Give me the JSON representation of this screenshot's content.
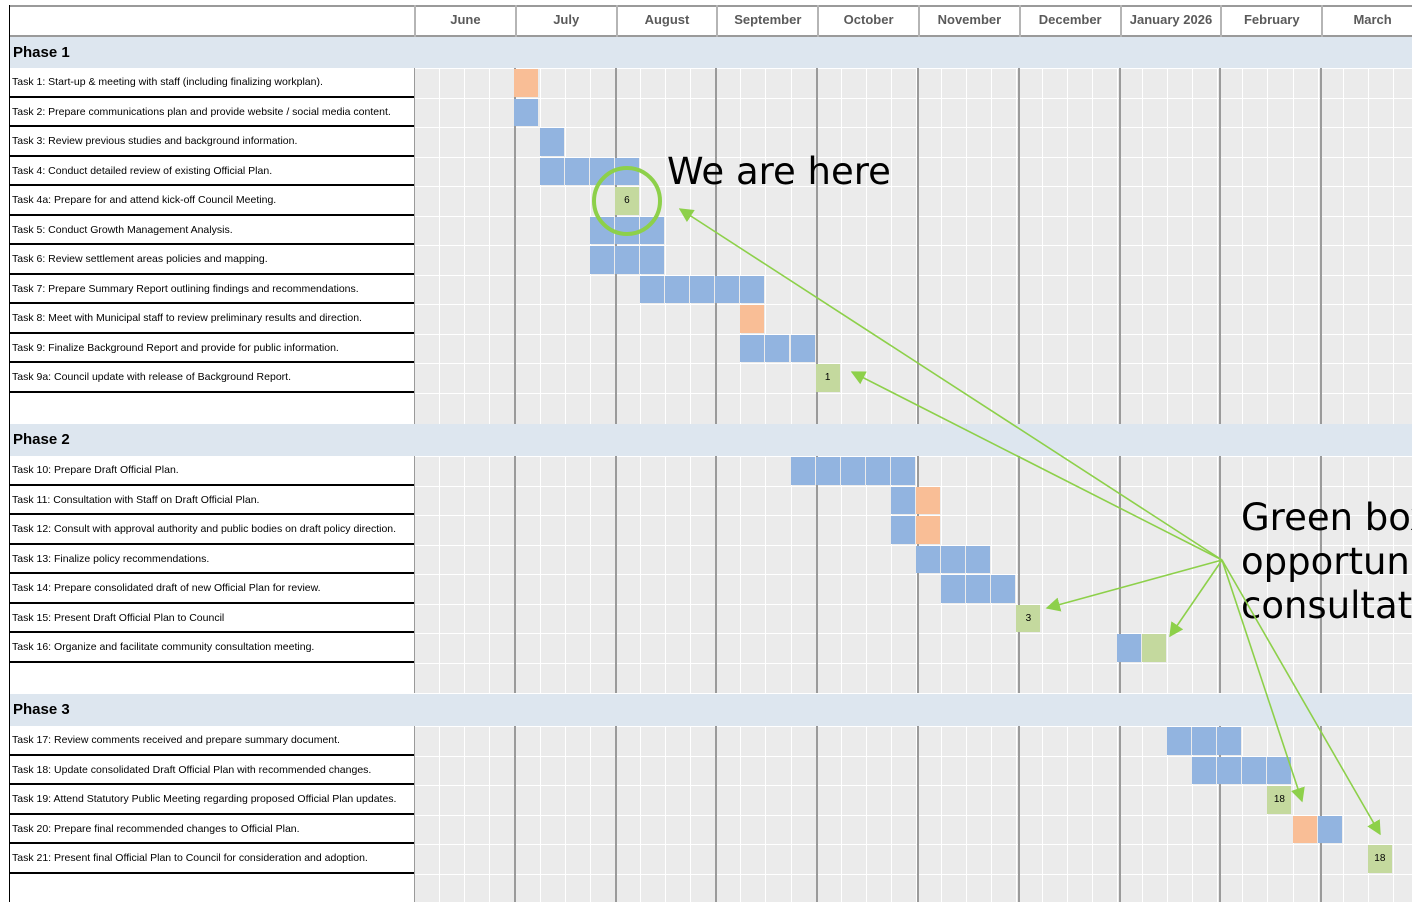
{
  "months": [
    "June",
    "July",
    "August",
    "September",
    "October",
    "November",
    "December",
    "January 2026",
    "February",
    "March"
  ],
  "colors": {
    "task": "#92b4e0",
    "meeting": "#f9be96",
    "consult": "#c4d99e",
    "phase_bg": "#dde6ef",
    "grid_bg": "#ebebeb",
    "arrow": "#8dd04a"
  },
  "phases": [
    {
      "name": "Phase 1",
      "tasks": [
        {
          "label": "Task 1: Start-up & meeting with staff (including finalizing workplan).",
          "cells": [
            {
              "week": 4,
              "kind": "meeting"
            }
          ]
        },
        {
          "label": "Task 2: Prepare communications plan and provide website / social media content.",
          "cells": [
            {
              "week": 4,
              "kind": "task"
            }
          ]
        },
        {
          "label": "Task 3: Review previous studies and background information.",
          "cells": [
            {
              "week": 5,
              "kind": "task"
            }
          ]
        },
        {
          "label": "Task 4: Conduct detailed review of existing Official Plan.",
          "cells": [
            {
              "week": 5,
              "kind": "task"
            },
            {
              "week": 6,
              "kind": "task"
            },
            {
              "week": 7,
              "kind": "task"
            },
            {
              "week": 8,
              "kind": "task"
            }
          ]
        },
        {
          "label": "Task 4a: Prepare for and attend kick-off Council Meeting.",
          "cells": [
            {
              "week": 8,
              "kind": "consult",
              "text": "6"
            }
          ]
        },
        {
          "label": "Task 5: Conduct Growth Management Analysis.",
          "cells": [
            {
              "week": 7,
              "kind": "task"
            },
            {
              "week": 8,
              "kind": "task"
            },
            {
              "week": 9,
              "kind": "task"
            }
          ]
        },
        {
          "label": "Task 6: Review settlement areas policies and mapping.",
          "cells": [
            {
              "week": 7,
              "kind": "task"
            },
            {
              "week": 8,
              "kind": "task"
            },
            {
              "week": 9,
              "kind": "task"
            }
          ]
        },
        {
          "label": "Task 7: Prepare Summary Report outlining findings and recommendations.",
          "cells": [
            {
              "week": 9,
              "kind": "task"
            },
            {
              "week": 10,
              "kind": "task"
            },
            {
              "week": 11,
              "kind": "task"
            },
            {
              "week": 12,
              "kind": "task"
            },
            {
              "week": 13,
              "kind": "task"
            }
          ]
        },
        {
          "label": "Task 8: Meet with Municipal staff to review preliminary results and direction.",
          "cells": [
            {
              "week": 13,
              "kind": "meeting"
            }
          ]
        },
        {
          "label": "Task 9: Finalize Background Report and provide for public information.",
          "cells": [
            {
              "week": 13,
              "kind": "task"
            },
            {
              "week": 14,
              "kind": "task"
            },
            {
              "week": 15,
              "kind": "task"
            }
          ]
        },
        {
          "label": "Task 9a: Council update with release of Background Report.",
          "cells": [
            {
              "week": 16,
              "kind": "consult",
              "text": "1"
            }
          ]
        }
      ]
    },
    {
      "name": "Phase 2",
      "tasks": [
        {
          "label": "Task 10: Prepare Draft Official Plan.",
          "cells": [
            {
              "week": 15,
              "kind": "task"
            },
            {
              "week": 16,
              "kind": "task"
            },
            {
              "week": 17,
              "kind": "task"
            },
            {
              "week": 18,
              "kind": "task"
            },
            {
              "week": 19,
              "kind": "task"
            }
          ]
        },
        {
          "label": "Task 11: Consultation with Staff on Draft Official Plan.",
          "cells": [
            {
              "week": 19,
              "kind": "task"
            },
            {
              "week": 20,
              "kind": "meeting"
            }
          ]
        },
        {
          "label": "Task 12: Consult with approval authority and public bodies on draft policy direction.",
          "cells": [
            {
              "week": 19,
              "kind": "task"
            },
            {
              "week": 20,
              "kind": "meeting"
            }
          ]
        },
        {
          "label": "Task 13: Finalize policy recommendations.",
          "cells": [
            {
              "week": 20,
              "kind": "task"
            },
            {
              "week": 21,
              "kind": "task"
            },
            {
              "week": 22,
              "kind": "task"
            }
          ]
        },
        {
          "label": "Task 14: Prepare consolidated draft of new Official Plan for review.",
          "cells": [
            {
              "week": 21,
              "kind": "task"
            },
            {
              "week": 22,
              "kind": "task"
            },
            {
              "week": 23,
              "kind": "task"
            }
          ]
        },
        {
          "label": "Task 15: Present Draft Official Plan to Council",
          "cells": [
            {
              "week": 24,
              "kind": "consult",
              "text": "3"
            }
          ]
        },
        {
          "label": "Task 16: Organize and facilitate community consultation meeting.",
          "cells": [
            {
              "week": 28,
              "kind": "task"
            },
            {
              "week": 29,
              "kind": "consult"
            }
          ]
        }
      ]
    },
    {
      "name": "Phase 3",
      "tasks": [
        {
          "label": "Task 17: Review comments received and prepare summary document.",
          "cells": [
            {
              "week": 30,
              "kind": "task"
            },
            {
              "week": 31,
              "kind": "task"
            },
            {
              "week": 32,
              "kind": "task"
            }
          ]
        },
        {
          "label": "Task 18: Update consolidated Draft Official Plan with recommended changes.",
          "cells": [
            {
              "week": 31,
              "kind": "task"
            },
            {
              "week": 32,
              "kind": "task"
            },
            {
              "week": 33,
              "kind": "task"
            },
            {
              "week": 34,
              "kind": "task"
            }
          ]
        },
        {
          "label": "Task 19: Attend Statutory Public Meeting regarding proposed Official Plan updates.",
          "cells": [
            {
              "week": 34,
              "kind": "consult",
              "text": "18"
            }
          ]
        },
        {
          "label": "Task 20: Prepare final recommended changes to Official Plan.",
          "cells": [
            {
              "week": 35,
              "kind": "meeting"
            },
            {
              "week": 36,
              "kind": "task"
            }
          ]
        },
        {
          "label": "Task 21: Present final Official Plan to Council for consideration and adoption.",
          "cells": [
            {
              "week": 38,
              "kind": "consult",
              "text": "18"
            }
          ]
        }
      ]
    }
  ],
  "annotations": {
    "we_are_here": "We are here",
    "green_boxes_lines": [
      "Green box",
      "opportunit",
      "consultatio"
    ]
  }
}
